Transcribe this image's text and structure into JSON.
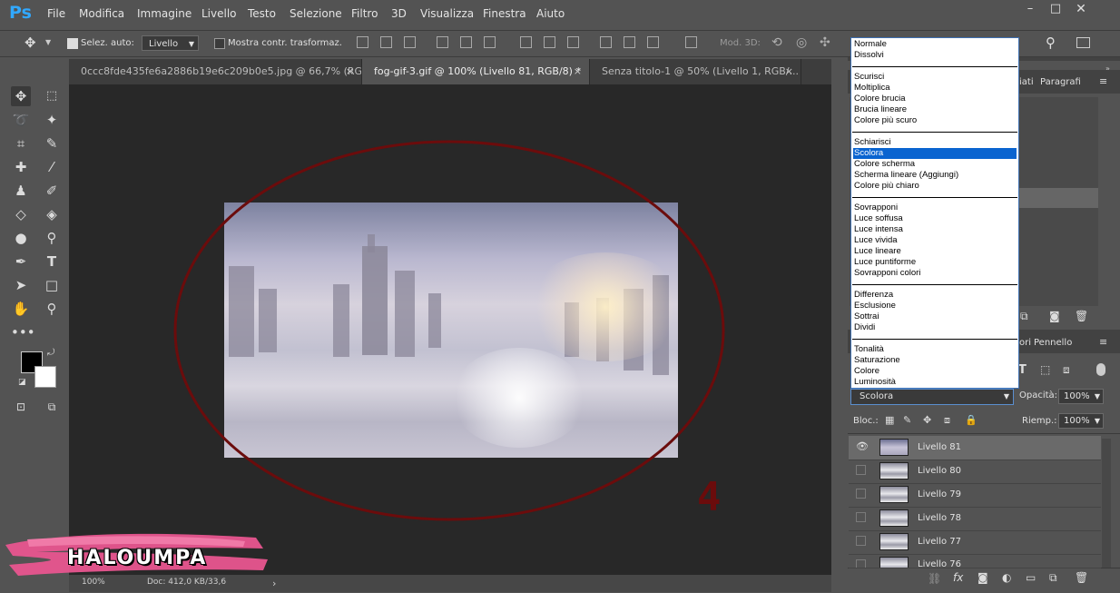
{
  "app": {
    "logo": "Ps"
  },
  "menubar": {
    "items": [
      "File",
      "Modifica",
      "Immagine",
      "Livello",
      "Testo",
      "Selezione",
      "Filtro",
      "3D",
      "Visualizza",
      "Finestra",
      "Aiuto"
    ],
    "window_controls": {
      "minimize": "–",
      "maximize": "□",
      "close": "✕"
    }
  },
  "options_bar": {
    "auto_select_label": "Selez. auto:",
    "auto_select_value": "Livello",
    "show_transform_label": "Mostra contr. trasformaz.",
    "mode_3d_label": "Mod. 3D:"
  },
  "tabs": [
    {
      "label": "0ccc8fde435fe6a2886b19e6c209b0e5.jpg @ 66,7% (RG...",
      "close": "×"
    },
    {
      "label": "fog-gif-3.gif @ 100% (Livello 81, RGB/8) *",
      "close": "×"
    },
    {
      "label": "Senza titolo-1 @ 50% (Livello 1, RGB/...",
      "close": "×"
    }
  ],
  "right_panel": {
    "top_tabs": [
      "iati",
      "Paragrafi"
    ],
    "mid_tabs": [
      "ori",
      "Pennello"
    ],
    "blend_mode_selected": "Scolora",
    "opacity_label": "Opacità:",
    "opacity_value": "100%",
    "lock_label": "Bloc.:",
    "fill_label": "Riemp.:",
    "fill_value": "100%"
  },
  "blend_modes": [
    [
      "Normale",
      "Dissolvi"
    ],
    [
      "Scurisci",
      "Moltiplica",
      "Colore brucia",
      "Brucia lineare",
      "Colore più scuro"
    ],
    [
      "Schiarisci",
      "Scolora",
      "Colore scherma",
      "Scherma lineare (Aggiungi)",
      "Colore più chiaro"
    ],
    [
      "Sovrapponi",
      "Luce soffusa",
      "Luce intensa",
      "Luce vivida",
      "Luce lineare",
      "Luce puntiforme",
      "Sovrapponi colori"
    ],
    [
      "Differenza",
      "Esclusione",
      "Sottrai",
      "Dividi"
    ],
    [
      "Tonalità",
      "Saturazione",
      "Colore",
      "Luminosità"
    ]
  ],
  "layers": [
    {
      "name": "Livello 81",
      "visible": true,
      "selected": true
    },
    {
      "name": "Livello 80",
      "visible": false,
      "selected": false
    },
    {
      "name": "Livello 79",
      "visible": false,
      "selected": false
    },
    {
      "name": "Livello 78",
      "visible": false,
      "selected": false
    },
    {
      "name": "Livello 77",
      "visible": false,
      "selected": false
    },
    {
      "name": "Livello 76",
      "visible": false,
      "selected": false
    }
  ],
  "status": {
    "zoom": "100%",
    "doc": "Doc: 412,0 KB/33,6"
  },
  "overlay": {
    "watermark": "HALOUMPA",
    "step_number": "4"
  },
  "colors": {
    "accent": "#31a8ff",
    "highlight": "#0a64d0",
    "annotation": "#6b0c0c"
  }
}
